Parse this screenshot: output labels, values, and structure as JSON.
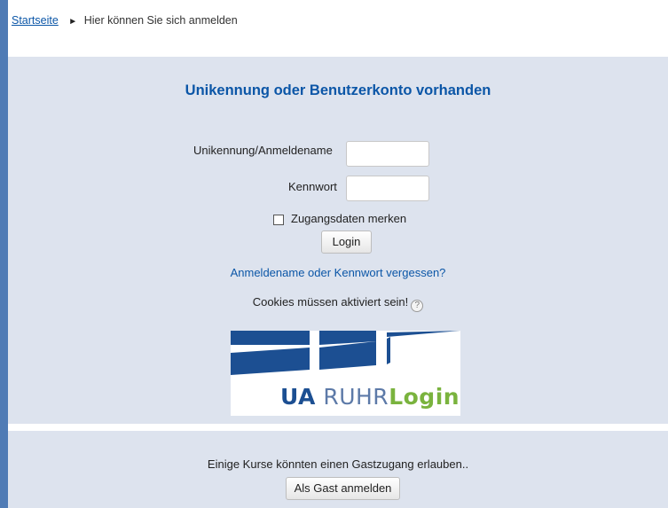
{
  "breadcrumb": {
    "home_link": "Startseite",
    "separator": "►",
    "current": "Hier können Sie sich anmelden"
  },
  "login": {
    "title": "Unikennung oder Benutzerkonto vorhanden",
    "username_label": "Unikennung/Anmeldename",
    "username_value": "",
    "password_label": "Kennwort",
    "password_value": "",
    "remember_label": "Zugangsdaten merken",
    "remember_checked": false,
    "login_button": "Login",
    "forgot_link": "Anmeldename oder Kennwort vergessen?",
    "cookies_notice": "Cookies müssen aktiviert sein!",
    "help_icon": "help-circle-icon",
    "help_glyph": "?"
  },
  "logo": {
    "ua": "UA",
    "ruhr": "RUHR",
    "login": "Login",
    "colors": {
      "ua": "#1c4f92",
      "ruhr": "#5d7aa8",
      "login": "#7ab33e"
    }
  },
  "guest": {
    "text": "Einige Kurse könnten einen Gastzugang erlauben..",
    "button": "Als Gast anmelden"
  },
  "colors": {
    "accent": "#0b56a7",
    "panel_bg": "#dde3ee",
    "frame_border": "#4f7bb5"
  }
}
